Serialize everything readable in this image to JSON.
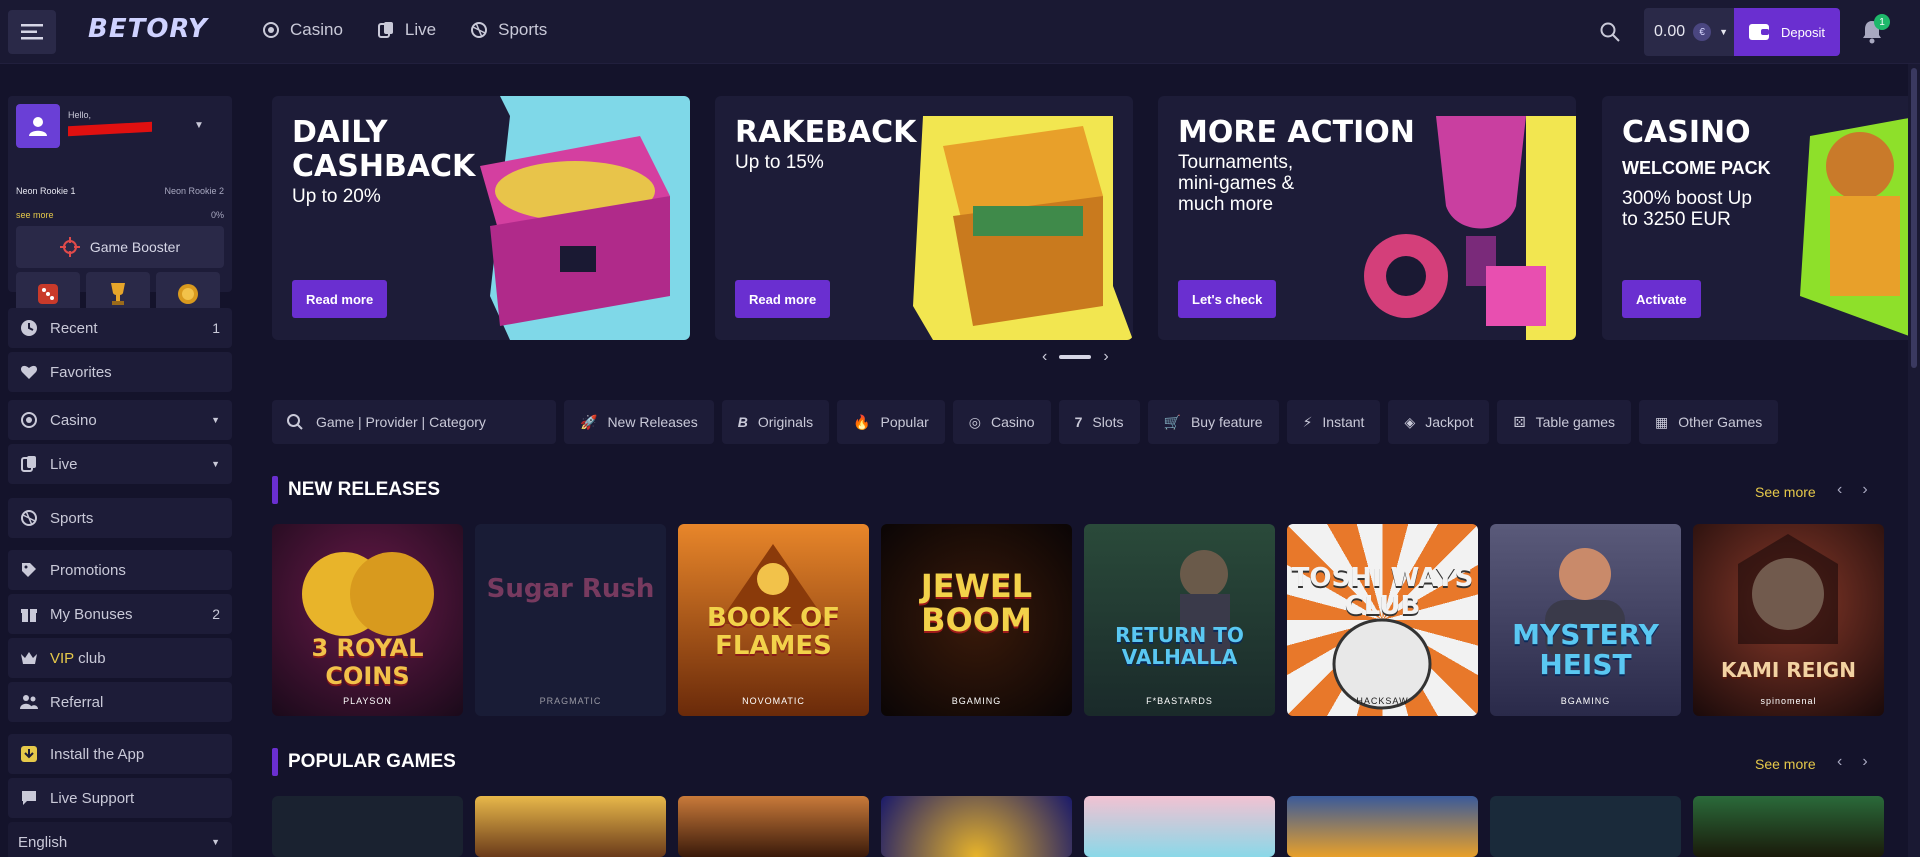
{
  "header": {
    "logo": "BETORY",
    "nav": [
      {
        "label": "Casino",
        "icon": "casino-chip-icon"
      },
      {
        "label": "Live",
        "icon": "live-cards-icon"
      },
      {
        "label": "Sports",
        "icon": "sports-ball-icon"
      }
    ],
    "balance": "0.00",
    "currency_symbol": "€",
    "deposit_label": "Deposit",
    "notification_count": "1"
  },
  "profile": {
    "greeting": "Hello,",
    "rank_current": "Neon Rookie 1",
    "rank_next": "Neon Rookie 2",
    "see_more": "see more",
    "progress": "0%",
    "booster_label": "Game Booster"
  },
  "sidebar": {
    "group1": [
      {
        "label": "Recent",
        "count": "1"
      },
      {
        "label": "Favorites",
        "count": ""
      }
    ],
    "group2": [
      {
        "label": "Casino"
      },
      {
        "label": "Live"
      }
    ],
    "group3": [
      {
        "label": "Sports"
      }
    ],
    "group4": [
      {
        "label": "Promotions",
        "count": ""
      },
      {
        "label": "My Bonuses",
        "count": "2"
      },
      {
        "label_gold": "VIP",
        "label": "club"
      },
      {
        "label": "Referral"
      }
    ],
    "group5": [
      {
        "label": "Install the App"
      },
      {
        "label": "Live Support"
      }
    ],
    "language": "English"
  },
  "banners": [
    {
      "title": "DAILY CASHBACK",
      "sub": "Up to 20%",
      "button": "Read more"
    },
    {
      "title": "RAKEBACK",
      "sub": "Up to 15%",
      "button": "Read more"
    },
    {
      "title": "MORE ACTION",
      "sub": "Tournaments, mini-games & much more",
      "button": "Let's check"
    },
    {
      "title": "CASINO",
      "sub_title": "WELCOME PACK",
      "sub": "300% boost Up to 3250 EUR",
      "button": "Activate"
    }
  ],
  "filters": {
    "search_placeholder": "Game | Provider | Category",
    "chips": [
      "New Releases",
      "Originals",
      "Popular",
      "Casino",
      "Slots",
      "Buy feature",
      "Instant",
      "Jackpot",
      "Table games",
      "Other Games"
    ]
  },
  "sections": {
    "new_releases": {
      "title": "NEW RELEASES",
      "see_more": "See more",
      "games": [
        {
          "title": "3 ROYAL COINS",
          "provider": "PLAYSON"
        },
        {
          "title": "Sugar Rush",
          "provider": "PRAGMATIC"
        },
        {
          "title": "BOOK OF FLAMES",
          "provider": "NOVOMATIC"
        },
        {
          "title": "JEWEL BOOM",
          "provider": "BGAMING"
        },
        {
          "title": "RETURN TO VALHALLA",
          "provider": "F*BASTARDS"
        },
        {
          "title": "TOSHI WAYS CLUB",
          "provider": "HACKSAW"
        },
        {
          "title": "MYSTERY HEIST",
          "provider": "BGAMING"
        },
        {
          "title": "KAMI REIGN",
          "provider": "spinomenal"
        }
      ]
    },
    "popular": {
      "title": "POPULAR GAMES",
      "see_more": "See more"
    }
  },
  "colors": {
    "accent": "#6a2fd0",
    "gold": "#e6c94a",
    "bg": "#14132b",
    "panel": "#1d1c38"
  }
}
